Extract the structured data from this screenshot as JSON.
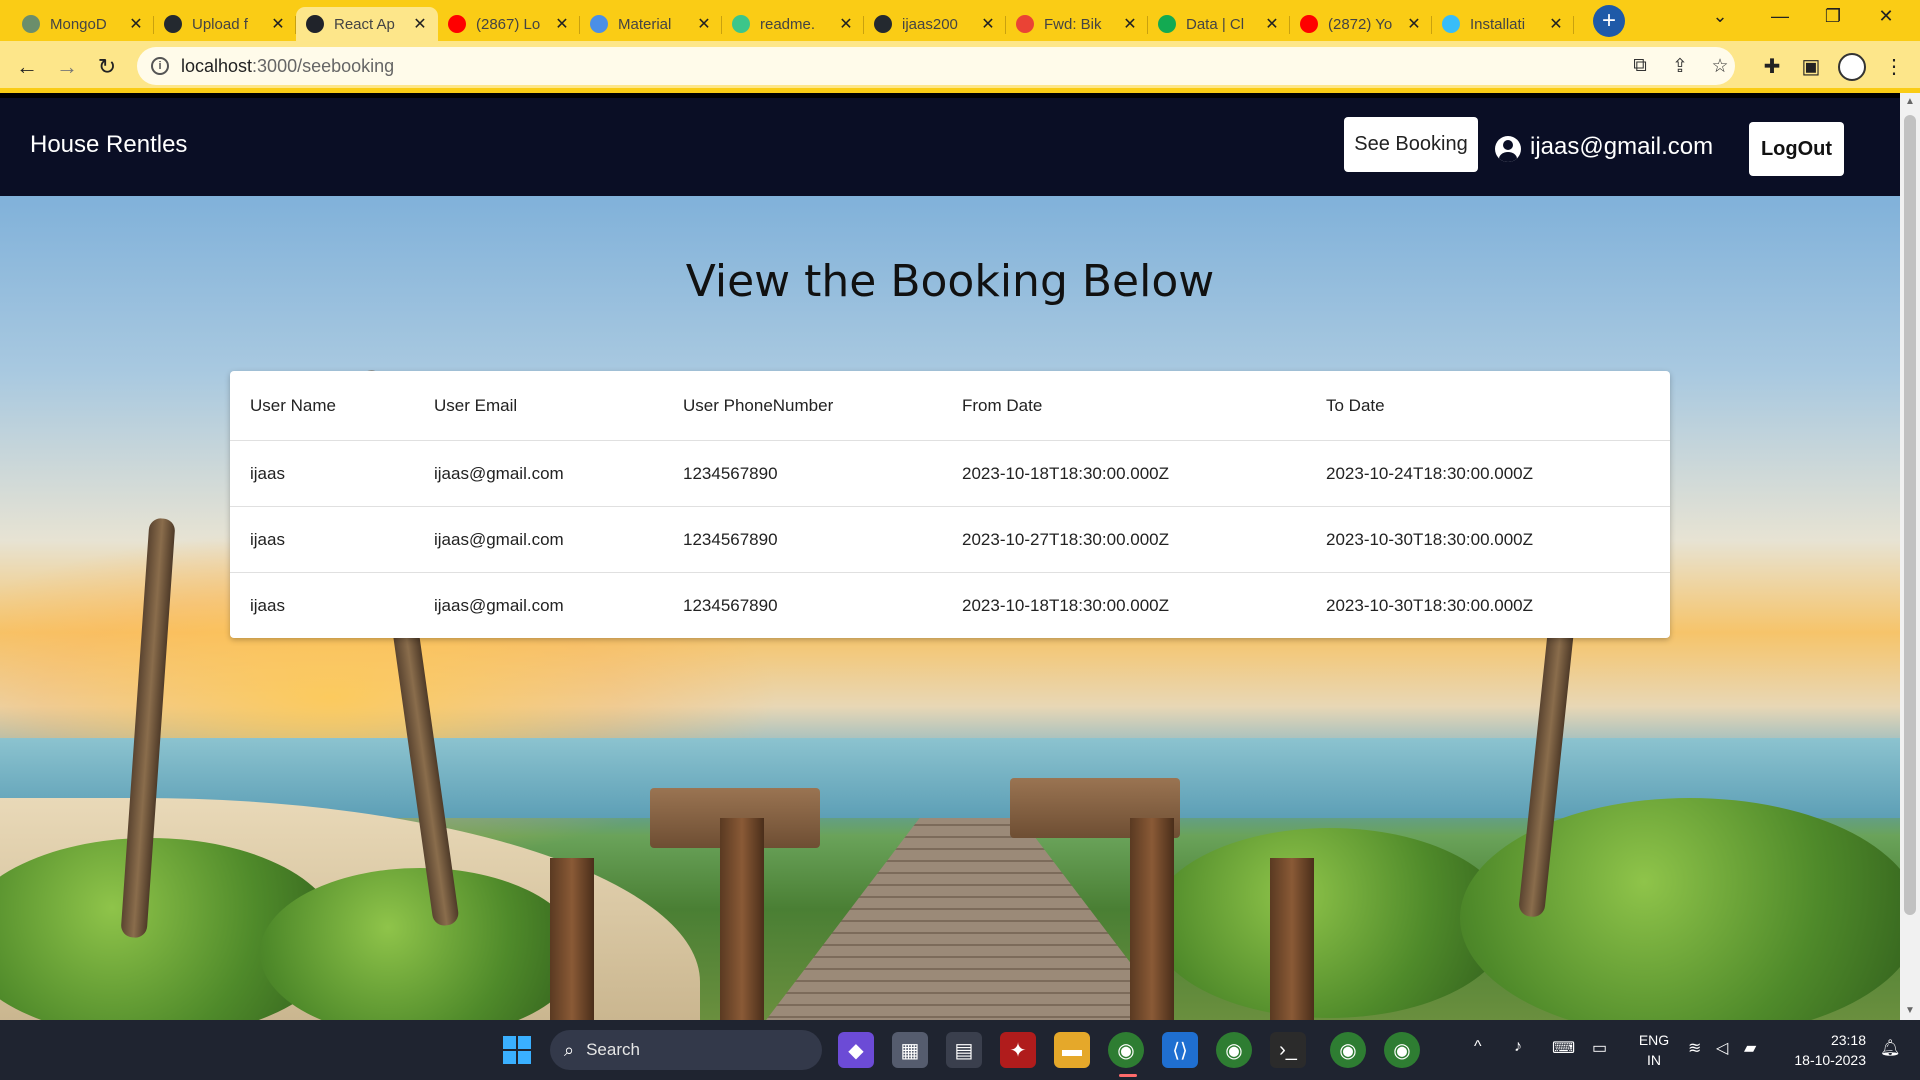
{
  "browser": {
    "tabs": [
      {
        "title": "MongoD",
        "favicon_color": "#6b8e6b",
        "active": false
      },
      {
        "title": "Upload f",
        "favicon_color": "#24292f",
        "active": false
      },
      {
        "title": "React Ap",
        "favicon_color": "#20232a",
        "active": true
      },
      {
        "title": "(2867) Lo",
        "favicon_color": "#ff0000",
        "active": false
      },
      {
        "title": "Material",
        "favicon_color": "#4a8fe7",
        "active": false
      },
      {
        "title": "readme.",
        "favicon_color": "#3cc68a",
        "active": false
      },
      {
        "title": "ijaas200",
        "favicon_color": "#24292f",
        "active": false
      },
      {
        "title": "Fwd: Bik",
        "favicon_color": "#ea4335",
        "active": false
      },
      {
        "title": "Data | Cl",
        "favicon_color": "#13aa52",
        "active": false
      },
      {
        "title": "(2872) Yo",
        "favicon_color": "#ff0000",
        "active": false
      },
      {
        "title": "Installati",
        "favicon_color": "#38bdf8",
        "active": false
      }
    ],
    "url_host": "localhost",
    "url_path": ":3000/seebooking"
  },
  "nav": {
    "brand": "House Rentles",
    "see_booking": "See Booking",
    "user_email": "ijaas@gmail.com",
    "logout": "LogOut"
  },
  "page": {
    "heading": "View the Booking Below"
  },
  "table": {
    "headers": [
      "User Name",
      "User Email",
      "User PhoneNumber",
      "From Date",
      "To Date"
    ],
    "rows": [
      [
        "ijaas",
        "ijaas@gmail.com",
        "1234567890",
        "2023-10-18T18:30:00.000Z",
        "2023-10-24T18:30:00.000Z"
      ],
      [
        "ijaas",
        "ijaas@gmail.com",
        "1234567890",
        "2023-10-27T18:30:00.000Z",
        "2023-10-30T18:30:00.000Z"
      ],
      [
        "ijaas",
        "ijaas@gmail.com",
        "1234567890",
        "2023-10-18T18:30:00.000Z",
        "2023-10-30T18:30:00.000Z"
      ]
    ]
  },
  "taskbar": {
    "search_label": "Search",
    "language_line1": "ENG",
    "language_line2": "IN",
    "time": "23:18",
    "date": "18-10-2023"
  },
  "colors": {
    "chrome_accent": "#facc15",
    "nav_background": "#0a0e25"
  }
}
